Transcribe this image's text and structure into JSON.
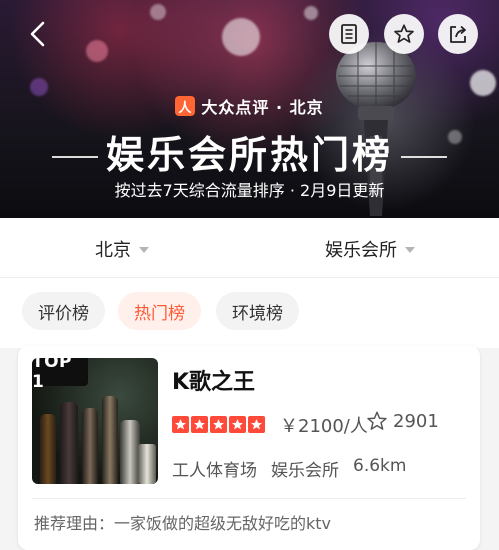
{
  "header": {
    "brand_name": "大众点评 · 北京",
    "brand_logo_char": "人",
    "title": "娱乐会所热门榜",
    "subtitle": "按过去7天综合流量排序 · 2月9日更新",
    "icons": [
      "back-icon",
      "document-icon",
      "star-icon",
      "share-icon"
    ]
  },
  "filters": {
    "city": "北京",
    "category": "娱乐会所"
  },
  "tabs": [
    {
      "label": "评价榜",
      "active": false
    },
    {
      "label": "热门榜",
      "active": true
    },
    {
      "label": "环境榜",
      "active": false
    }
  ],
  "listing": {
    "badge": "TOP 1",
    "name": "K歌之王",
    "rating_stars": 5,
    "price": "￥2100/人",
    "favorites": "2901",
    "area": "工人体育场",
    "category": "娱乐会所",
    "distance": "6.6km",
    "reason": "推荐理由：一家饭做的超级无敌好吃的ktv"
  },
  "colors": {
    "accent": "#ff5a36",
    "star": "#ff4a3a",
    "brand": "#ff6633"
  }
}
